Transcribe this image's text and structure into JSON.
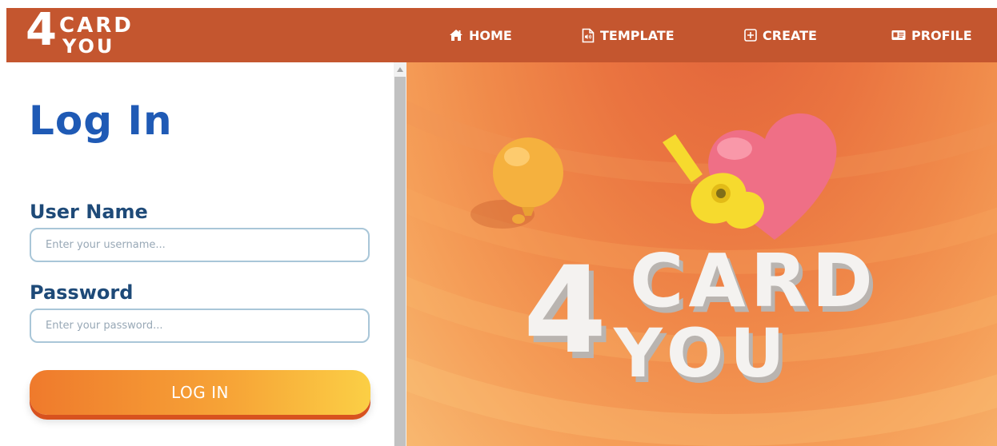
{
  "brand": {
    "logo_digit": "4",
    "logo_row1": "CARD",
    "logo_row2": "YOU",
    "colors": {
      "navbar": "#c4562f",
      "title": "#1f5ab5",
      "label": "#1e4a78",
      "button_start": "#ef7a2c",
      "button_end": "#fbcf45"
    }
  },
  "nav": {
    "items": [
      {
        "label": "HOME",
        "icon": "home-icon"
      },
      {
        "label": "TEMPLATE",
        "icon": "audio-file-icon"
      },
      {
        "label": "CREATE",
        "icon": "plus-square-icon"
      },
      {
        "label": "PROFILE",
        "icon": "id-card-icon"
      }
    ]
  },
  "login": {
    "title": "Log In",
    "username_label": "User Name",
    "username_placeholder": "Enter your username...",
    "password_label": "Password",
    "password_placeholder": "Enter your password...",
    "button_label": "LOG IN"
  },
  "hero": {
    "logo_digit": "4",
    "logo_row1": "CARD",
    "logo_row2": "YOU",
    "objects": [
      "balloon-icon",
      "guitar-icon",
      "heart-icon"
    ]
  }
}
